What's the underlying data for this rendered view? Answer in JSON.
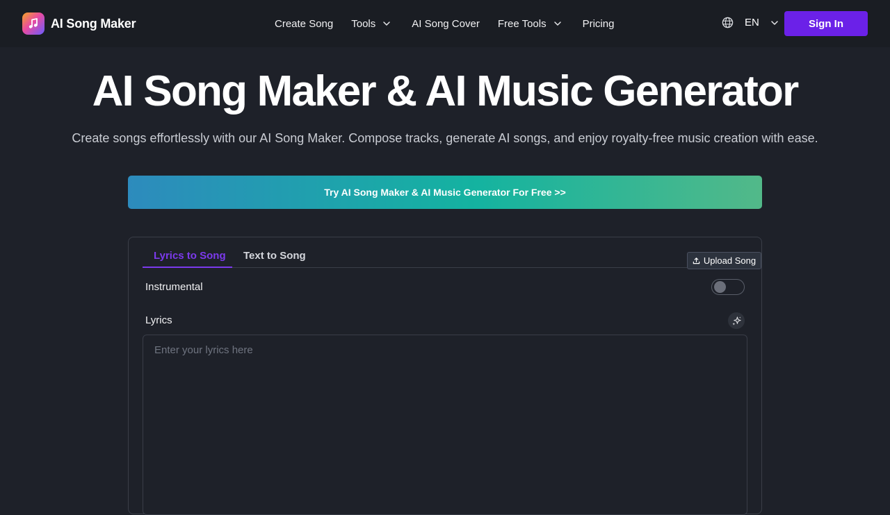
{
  "brand": {
    "name": "AI Song Maker",
    "logo_icon": "music-note-icon"
  },
  "nav": {
    "items": [
      {
        "label": "Create Song",
        "dropdown": false
      },
      {
        "label": "Tools",
        "dropdown": true
      },
      {
        "label": "AI Song Cover",
        "dropdown": false
      },
      {
        "label": "Free Tools",
        "dropdown": true
      },
      {
        "label": "Pricing",
        "dropdown": false
      }
    ]
  },
  "language": {
    "icon": "globe-icon",
    "current": "EN"
  },
  "auth": {
    "sign_in_label": "Sign In"
  },
  "hero": {
    "title": "AI Song Maker & AI Music Generator",
    "subtitle": "Create songs effortlessly with our AI Song Maker. Compose tracks, generate AI songs, and enjoy royalty-free music creation with ease.",
    "cta_label": "Try AI Song Maker & AI Music Generator For Free >>"
  },
  "form": {
    "tabs": [
      {
        "label": "Lyrics to Song",
        "active": true
      },
      {
        "label": "Text to Song",
        "active": false
      }
    ],
    "upload_label": "Upload Song",
    "instrumental_label": "Instrumental",
    "instrumental_on": false,
    "lyrics_label": "Lyrics",
    "lyrics_placeholder": "Enter your lyrics here",
    "lyrics_value": ""
  },
  "colors": {
    "background": "#1e2129",
    "header_bg": "#1a1d23",
    "accent": "#6b21e8",
    "tab_active": "#7c3aed",
    "cta_gradient_start": "#2d8bbd",
    "cta_gradient_end": "#52b989"
  }
}
